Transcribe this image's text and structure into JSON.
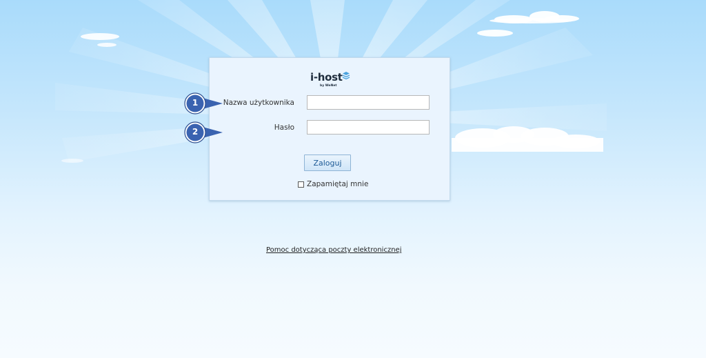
{
  "logo": {
    "name": "i-host",
    "tagline": "by WeNet"
  },
  "form": {
    "username_label": "Nazwa użytkownika",
    "username_value": "",
    "password_label": "Hasło",
    "password_value": "",
    "login_label": "Zaloguj",
    "remember_label": "Zapamiętaj mnie"
  },
  "annotations": [
    "1",
    "2"
  ],
  "help_link": "Pomoc dotycząca poczty elektronicznej",
  "colors": {
    "sky": "#a9dbfb",
    "box_bg": "#eaf4fe",
    "button_text": "#1c5a96",
    "callout": "#3a63b0"
  }
}
